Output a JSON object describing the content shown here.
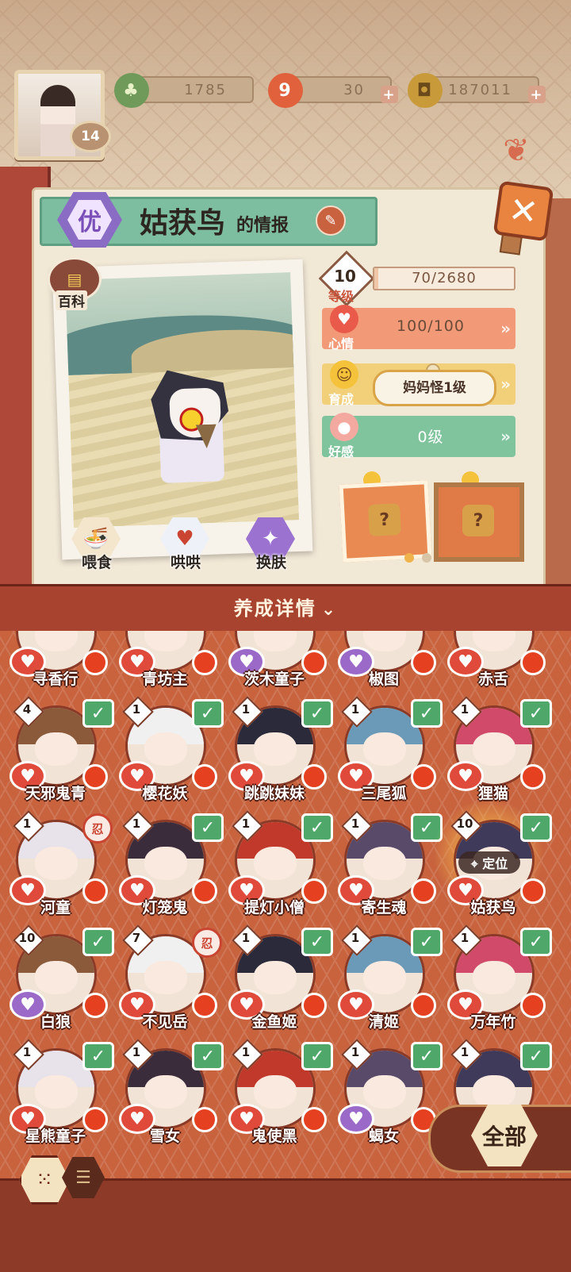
{
  "currency": {
    "jade": "1785",
    "stamina": "30",
    "coins": "187011",
    "plus": "+"
  },
  "player": {
    "level": "14"
  },
  "info_panel": {
    "quality_badge": "优",
    "name": "姑获鸟",
    "title_suffix": "的情报",
    "close_label": "✕",
    "wiki_label": "百科",
    "actions": [
      {
        "label": "喂食",
        "icon": "noodle-bowl-icon"
      },
      {
        "label": "哄哄",
        "icon": "milk-carton-icon"
      },
      {
        "label": "换肤",
        "icon": "outfit-icon"
      }
    ],
    "stats": {
      "level_num": "10",
      "level_label": "等级",
      "exp_text": "70/2680",
      "exp_fraction": 0.026,
      "mood_label": "心情",
      "mood_value": "100/100",
      "growth_label": "育成",
      "growth_value": "妈妈怪1级",
      "affection_label": "好感",
      "affection_value": "0级"
    },
    "wear_unknown": "?",
    "page_dots": 2,
    "page_active": 0
  },
  "detail_bar": {
    "label": "养成详情",
    "chevron": "⌄"
  },
  "shikigami_rows": [
    [
      {
        "name": "寻香行",
        "level": "",
        "badge": "",
        "heart": "red"
      },
      {
        "name": "青坊主",
        "level": "",
        "badge": "",
        "heart": "red"
      },
      {
        "name": "茨木童子",
        "level": "",
        "badge": "",
        "heart": "purple"
      },
      {
        "name": "椒图",
        "level": "",
        "badge": "",
        "heart": "purple"
      },
      {
        "name": "赤舌",
        "level": "",
        "badge": "",
        "heart": "red"
      }
    ],
    [
      {
        "name": "天邪鬼青",
        "level": "4",
        "badge": "check",
        "heart": "red"
      },
      {
        "name": "樱花妖",
        "level": "1",
        "badge": "check",
        "heart": "red"
      },
      {
        "name": "跳跳妹妹",
        "level": "1",
        "badge": "check",
        "heart": "red"
      },
      {
        "name": "三尾狐",
        "level": "1",
        "badge": "check",
        "heart": "red"
      },
      {
        "name": "狸猫",
        "level": "1",
        "badge": "check",
        "heart": "red"
      }
    ],
    [
      {
        "name": "河童",
        "level": "1",
        "badge": "seal",
        "heart": "red"
      },
      {
        "name": "灯笼鬼",
        "level": "1",
        "badge": "check",
        "heart": "red"
      },
      {
        "name": "提灯小僧",
        "level": "1",
        "badge": "check",
        "heart": "red"
      },
      {
        "name": "寄生魂",
        "level": "1",
        "badge": "check",
        "heart": "red"
      },
      {
        "name": "姑获鸟",
        "level": "10",
        "badge": "check",
        "heart": "red",
        "selected": true
      }
    ],
    [
      {
        "name": "白狼",
        "level": "10",
        "badge": "check",
        "heart": "purple"
      },
      {
        "name": "不见岳",
        "level": "7",
        "badge": "seal",
        "heart": "red"
      },
      {
        "name": "金鱼姬",
        "level": "1",
        "badge": "check",
        "heart": "red"
      },
      {
        "name": "清姬",
        "level": "1",
        "badge": "check",
        "heart": "red"
      },
      {
        "name": "万年竹",
        "level": "1",
        "badge": "check",
        "heart": "red"
      }
    ],
    [
      {
        "name": "星熊童子",
        "level": "1",
        "badge": "check",
        "heart": "red"
      },
      {
        "name": "雪女",
        "level": "1",
        "badge": "check",
        "heart": "red"
      },
      {
        "name": "鬼使黑",
        "level": "1",
        "badge": "check",
        "heart": "red"
      },
      {
        "name": "蝎女",
        "level": "1",
        "badge": "check",
        "heart": "purple"
      },
      {
        "name": "",
        "level": "1",
        "badge": "check",
        "heart": "none"
      }
    ]
  ],
  "locate_label": "定位",
  "seal_glyph": "忍",
  "all_button": "全部",
  "colors": {
    "accent_red": "#c8633e",
    "check_green": "#4fa86a",
    "mood_bar": "#f29a78",
    "growth_bar": "#f2d07a",
    "affection_bar": "#7fc49c"
  }
}
